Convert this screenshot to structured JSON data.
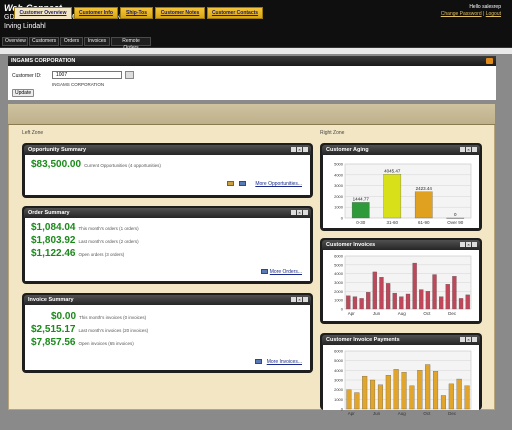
{
  "header": {
    "brand_main": "Web",
    "brand_sep": "-",
    "brand_rest": "Connect",
    "company": "GDC CONNECT SAMPLE COMPANY",
    "user": "Irving Lindahl",
    "welcome": "Hello salesrep",
    "change_password": "Change Password",
    "logout": "Logout"
  },
  "nav": [
    "Overview",
    "Customers",
    "Orders",
    "Invoices",
    "Remote Orders"
  ],
  "customer": {
    "title": "INGAMS CORPORATION",
    "id_label": "Customer ID:",
    "id_value": "1007",
    "name": "INGAMS CORPORATION",
    "update": "Update"
  },
  "tabs": [
    "Customer Overview",
    "Customer Info",
    "Ship-Tos",
    "Customer Notes",
    "Customer Contacts"
  ],
  "zones": {
    "left": "Left Zone",
    "right": "Right Zone"
  },
  "opportunity": {
    "title": "Opportunity Summary",
    "value": "$83,500.00",
    "text": "Current Opportunities (4 opportunities)",
    "more": "More Opportunities..."
  },
  "orders": {
    "title": "Order Summary",
    "rows": [
      {
        "value": "$1,084.04",
        "text": "This month's orders (1 orders)"
      },
      {
        "value": "$1,803.92",
        "text": "Last month's orders (2 orders)"
      },
      {
        "value": "$1,122.46",
        "text": "Open orders (3 orders)"
      }
    ],
    "more": "More Orders..."
  },
  "invoices": {
    "title": "Invoice Summary",
    "rows": [
      {
        "value": "$0.00",
        "text": "This month's invoices (0 invoices)"
      },
      {
        "value": "$2,515.17",
        "text": "Last month's invoices (20 invoices)"
      },
      {
        "value": "$7,857.56",
        "text": "Open invoices (65 invoices)"
      }
    ],
    "more": "More Invoices..."
  },
  "aging": {
    "title": "Customer Aging",
    "icons": [
      "minimize-icon",
      "close-icon",
      "resize-icon"
    ]
  },
  "cust_invoices": {
    "title": "Customer Invoices"
  },
  "cust_payments": {
    "title": "Customer Invoice Payments"
  },
  "chart_data": [
    {
      "type": "bar",
      "title": "Customer Aging",
      "categories": [
        "0-30",
        "31-60",
        "61-90",
        "Over 90"
      ],
      "values": [
        1444.77,
        4045.47,
        2423.44,
        0
      ],
      "data_labels": [
        "1444.77",
        "4045.47",
        "2423.44",
        "0"
      ],
      "colors": [
        "#2e9a3a",
        "#d8e01a",
        "#e0a020",
        "#999999"
      ],
      "yticks": [
        "0",
        "1000",
        "2000",
        "3000",
        "4000",
        "5000"
      ],
      "ylim": [
        0,
        5000
      ]
    },
    {
      "type": "bar",
      "title": "Customer Invoices",
      "categories": [
        "Apr",
        "May",
        "Jun",
        "Jul",
        "Aug",
        "Sep",
        "Oct",
        "Nov",
        "Dec",
        "Jan"
      ],
      "xtick_labels": [
        "Apr",
        "",
        "Jun",
        "",
        "Aug",
        "",
        "Oct",
        "",
        "Dec",
        ""
      ],
      "values": [
        1500,
        1400,
        1200,
        1900,
        4200,
        3600,
        2900,
        1800,
        1400,
        1700,
        5200,
        2200,
        2000,
        3900,
        1400,
        2800,
        3700,
        1200,
        1600
      ],
      "color": "#c0465a",
      "yticks": [
        "0",
        "1000",
        "2000",
        "3000",
        "4000",
        "5000",
        "6000"
      ],
      "ylim": [
        0,
        6000
      ]
    },
    {
      "type": "bar",
      "title": "Customer Invoice Payments",
      "categories": [
        "Apr",
        "May",
        "Jun",
        "Jul",
        "Aug",
        "Sep",
        "Oct",
        "Nov",
        "Dec",
        "Jan"
      ],
      "xtick_labels": [
        "Apr",
        "",
        "Jun",
        "",
        "Aug",
        "",
        "Oct",
        "",
        "Dec",
        ""
      ],
      "values": [
        2000,
        1700,
        3400,
        3000,
        2500,
        3500,
        4100,
        3800,
        2400,
        4000,
        4600,
        3900,
        1400,
        2600,
        3100,
        2400
      ],
      "color": "#e0a52a",
      "yticks": [
        "0",
        "1000",
        "2000",
        "3000",
        "4000",
        "5000",
        "6000"
      ],
      "ylim": [
        0,
        6000
      ]
    }
  ]
}
